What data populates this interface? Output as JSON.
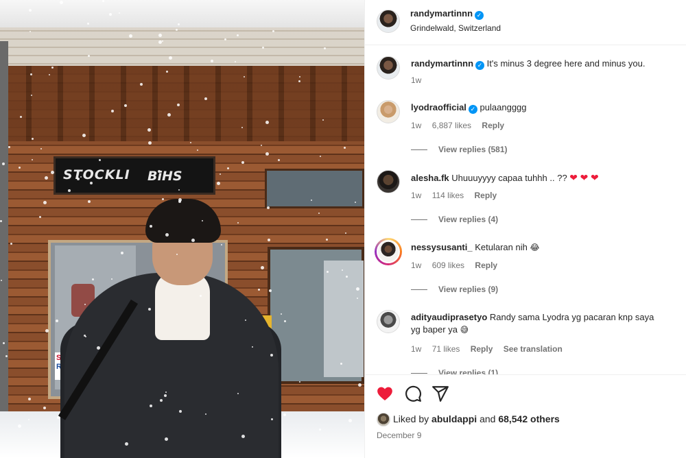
{
  "post": {
    "author": "randymartinnn",
    "location": "Grindelwald, Switzerland"
  },
  "caption": {
    "user": "randymartinnn",
    "text": "It's minus 3 degree here and minus you.",
    "time": "1w"
  },
  "comments": [
    {
      "user": "lyodraofficial",
      "verified": true,
      "text": "pulaangggg",
      "time": "1w",
      "likes": "6,887 likes",
      "reply": "Reply",
      "view_replies": "View replies (581)"
    },
    {
      "user": "alesha.fk",
      "verified": false,
      "text": "Uhuuuyyyy capaa tuhhh .. ??",
      "time": "1w",
      "likes": "114 likes",
      "reply": "Reply",
      "view_replies": "View replies (4)"
    },
    {
      "user": "nessysusanti_",
      "verified": false,
      "text": "Ketularan nih",
      "time": "1w",
      "likes": "609 likes",
      "reply": "Reply",
      "view_replies": "View replies (9)"
    },
    {
      "user": "adityaudiprasetyo",
      "verified": false,
      "text": "Randy sama Lyodra yg pacaran knp saya yg baper ya",
      "time": "1w",
      "likes": "71 likes",
      "reply": "Reply",
      "see_translation": "See translation",
      "view_replies": "View replies (1)"
    }
  ],
  "likes_line": {
    "prefix": "Liked by",
    "liker": "abuldappi",
    "joiner": "and",
    "others": "68,542 others"
  },
  "date": "December 9",
  "photo": {
    "sign_left": "STOCKLI",
    "sign_right": "BiHS",
    "ski_sign_1": "SKI",
    "ski_sign_2": "REN"
  },
  "colors": {
    "verified": "#0095f6",
    "like_heart": "#ed1c3a",
    "muted_text": "#737373"
  },
  "icons": {
    "verified": "verified-badge-icon",
    "like": "heart-filled-icon",
    "comment": "comment-bubble-icon",
    "share": "paper-plane-icon"
  }
}
